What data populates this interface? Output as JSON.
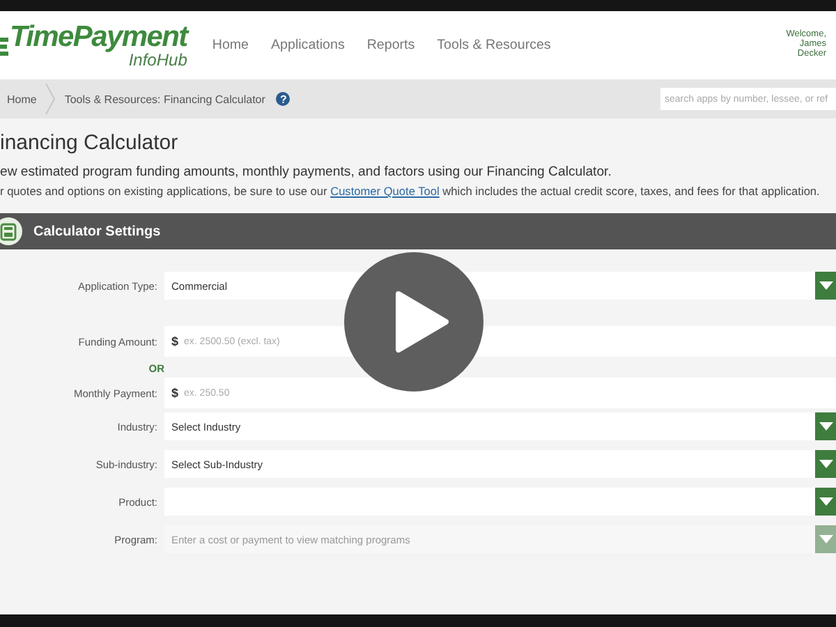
{
  "header": {
    "logo_title": "TimePayment",
    "logo_subtitle": "InfoHub",
    "nav": [
      {
        "label": "Home"
      },
      {
        "label": "Applications"
      },
      {
        "label": "Reports"
      },
      {
        "label": "Tools & Resources"
      }
    ],
    "welcome": [
      "Welcome,",
      "James",
      "Decker"
    ]
  },
  "breadcrumb": {
    "items": [
      "Home",
      "Tools & Resources: Financing Calculator"
    ],
    "help": "?",
    "search": {
      "placeholder": "search apps by number, lessee, or ref"
    }
  },
  "page": {
    "title": "inancing Calculator",
    "lead": "ew estimated program funding amounts, monthly payments, and factors using our Financing Calculator.",
    "note_before": "r quotes and options on existing applications, be sure to use our ",
    "note_link": "Customer Quote Tool",
    "note_after": " which includes the actual credit score, taxes, and fees for that application."
  },
  "settings": {
    "title": "Calculator Settings",
    "fields": [
      {
        "kind": "select",
        "label": "Application Type:",
        "value": "Commercial",
        "disabled": false
      },
      {
        "kind": "money",
        "label": "Funding Amount:",
        "prefix": "$",
        "placeholder": "ex. 2500.50 (excl. tax)"
      },
      {
        "kind": "or",
        "label": "OR"
      },
      {
        "kind": "money",
        "label": "Monthly Payment:",
        "prefix": "$",
        "placeholder": "ex. 250.50"
      },
      {
        "kind": "select",
        "label": "Industry:",
        "value": "Select Industry",
        "disabled": false
      },
      {
        "kind": "select",
        "label": "Sub-industry:",
        "value": "Select Sub-Industry",
        "disabled": false
      },
      {
        "kind": "select",
        "label": "Product:",
        "disabled": false
      },
      {
        "kind": "select",
        "label": "Program:",
        "placeholder": "Enter a cost or payment to view matching programs",
        "disabled": true
      }
    ]
  }
}
